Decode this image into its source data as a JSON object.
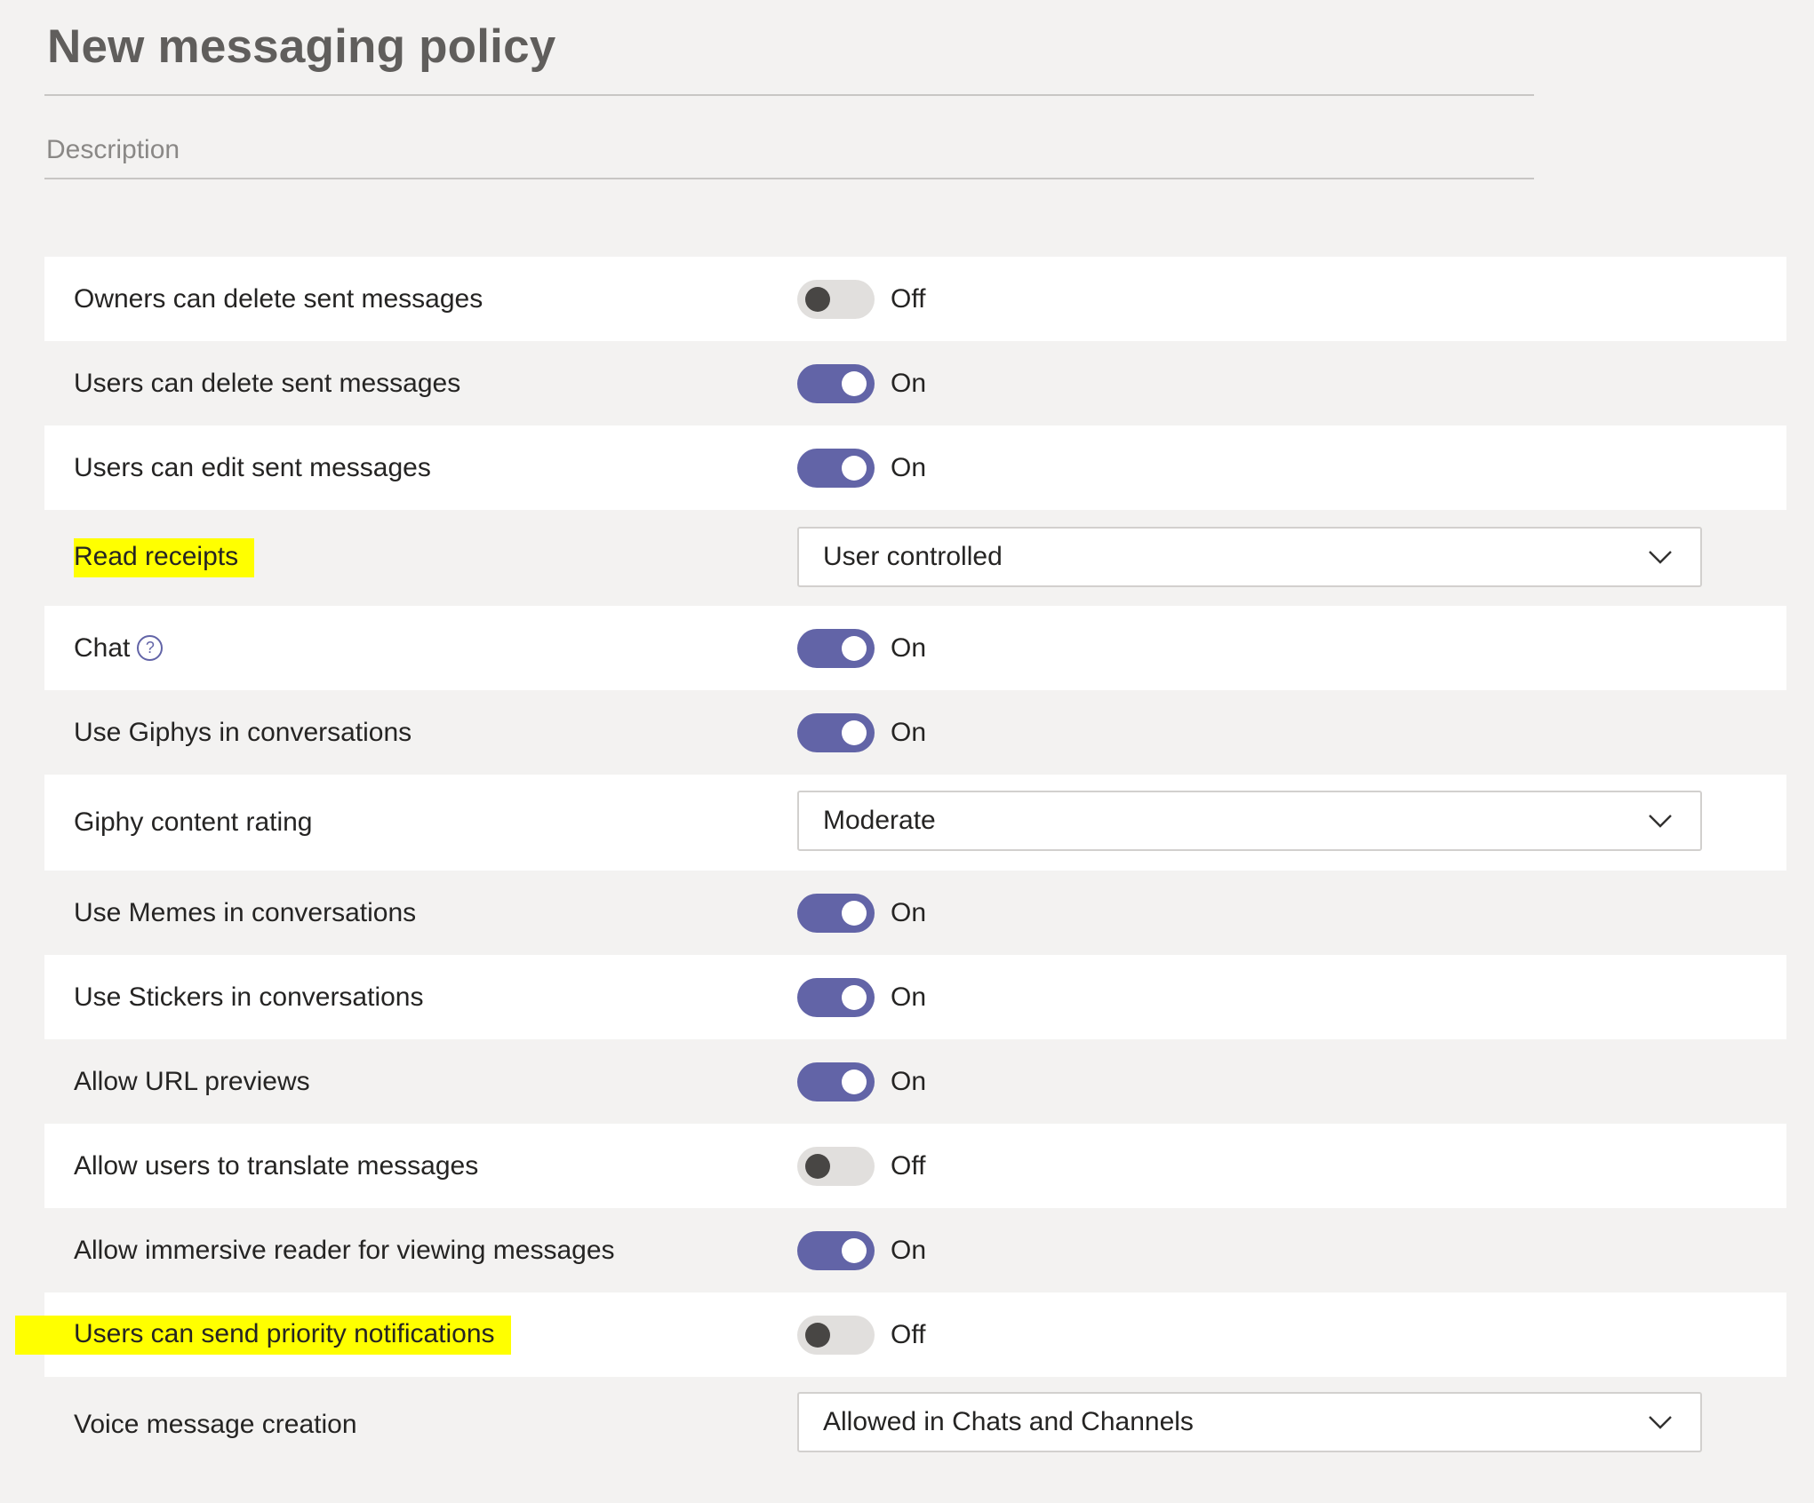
{
  "page": {
    "title": "New messaging policy",
    "description_placeholder": "Description"
  },
  "settings": [
    {
      "label": "Owners can delete sent messages",
      "type": "toggle",
      "on": false,
      "state": "Off"
    },
    {
      "label": "Users can delete sent messages",
      "type": "toggle",
      "on": true,
      "state": "On"
    },
    {
      "label": "Users can edit sent messages",
      "type": "toggle",
      "on": true,
      "state": "On"
    },
    {
      "label": "Read receipts",
      "type": "dropdown",
      "value": "User controlled",
      "highlighted": true
    },
    {
      "label": "Chat",
      "type": "toggle",
      "on": true,
      "state": "On",
      "help_icon": "?"
    },
    {
      "label": "Use Giphys in conversations",
      "type": "toggle",
      "on": true,
      "state": "On"
    },
    {
      "label": "Giphy content rating",
      "type": "dropdown",
      "value": "Moderate"
    },
    {
      "label": "Use Memes in conversations",
      "type": "toggle",
      "on": true,
      "state": "On"
    },
    {
      "label": "Use Stickers in conversations",
      "type": "toggle",
      "on": true,
      "state": "On"
    },
    {
      "label": "Allow URL previews",
      "type": "toggle",
      "on": true,
      "state": "On"
    },
    {
      "label": "Allow users to translate messages",
      "type": "toggle",
      "on": false,
      "state": "Off"
    },
    {
      "label": "Allow immersive reader for viewing messages",
      "type": "toggle",
      "on": true,
      "state": "On"
    },
    {
      "label": "Users can send priority notifications",
      "type": "toggle",
      "on": false,
      "state": "Off",
      "highlighted": true
    },
    {
      "label": "Voice message creation",
      "type": "dropdown",
      "value": "Allowed in Chats and Channels"
    }
  ],
  "icons": {
    "help": "question-circle-icon",
    "chevron": "chevron-down-icon"
  },
  "colors": {
    "toggle_on": "#6264a7",
    "toggle_off": "#e1dfdd",
    "highlight": "#ffff00",
    "row_white": "#ffffff",
    "page_bg": "#f3f2f1"
  }
}
